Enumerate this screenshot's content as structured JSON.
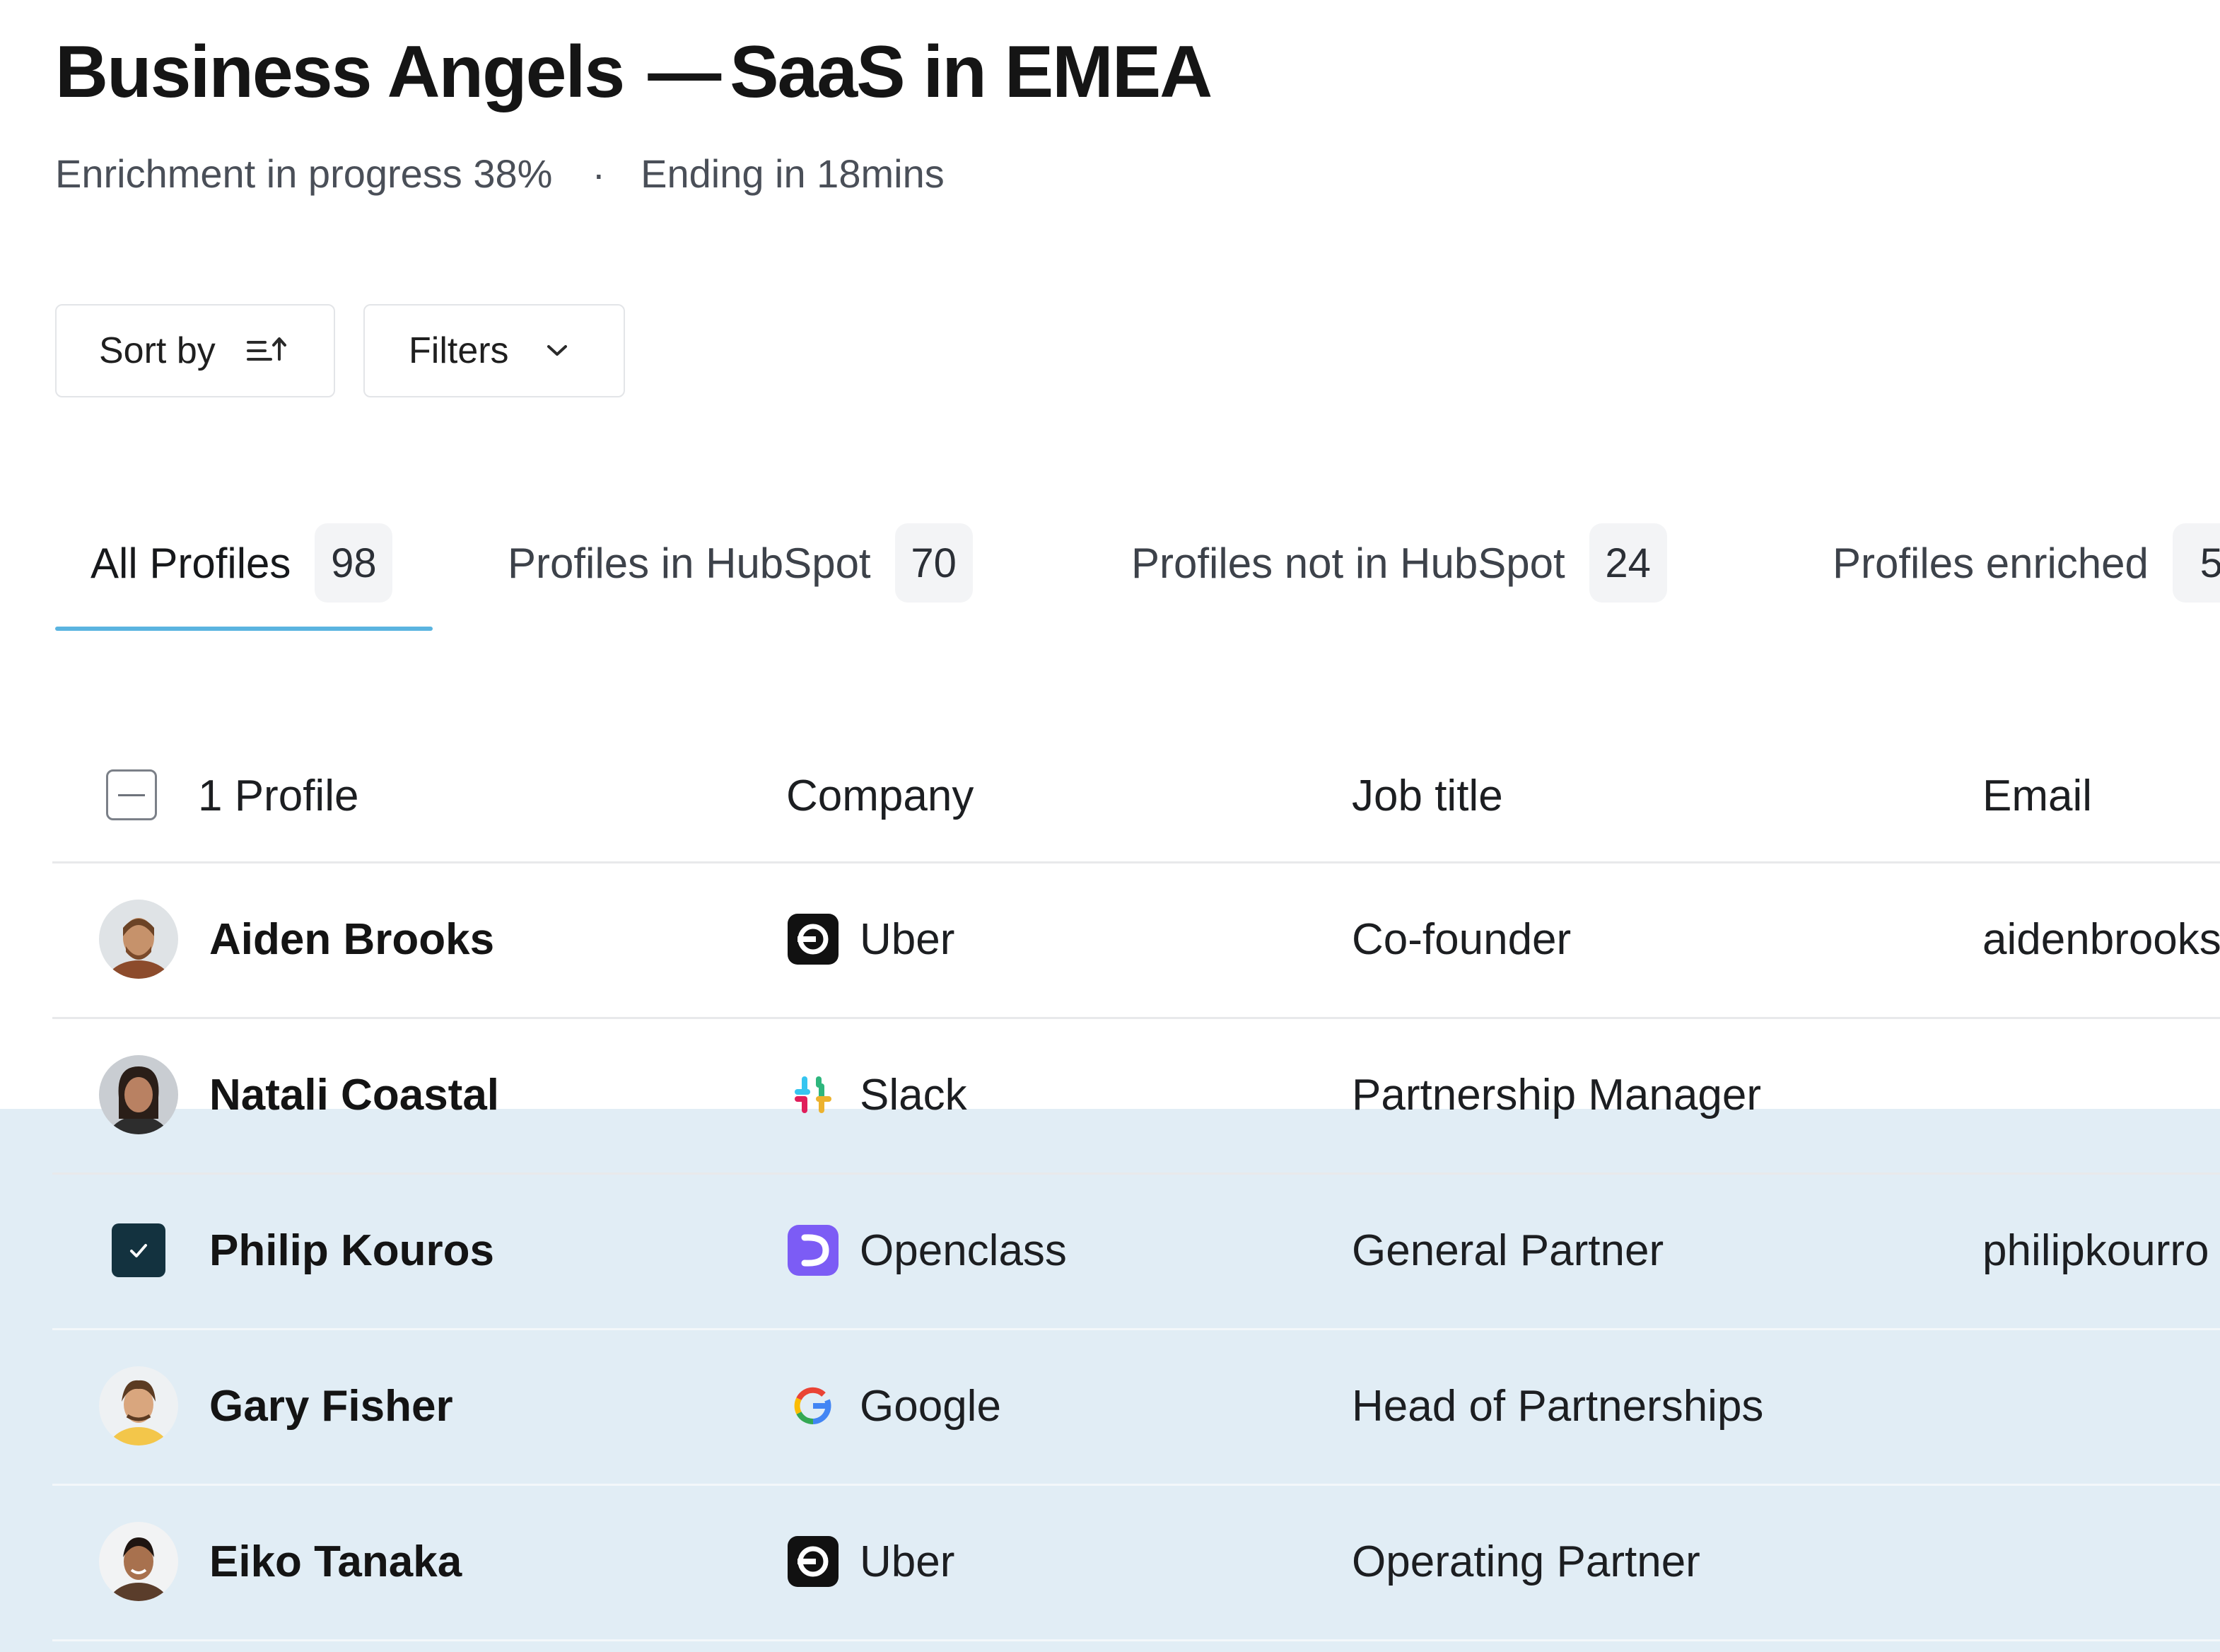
{
  "header": {
    "title_main": "Business Angels",
    "title_dash": "—",
    "title_rest": "SaaS in EMEA",
    "status": "Enrichment in progress 38%",
    "separator": "·",
    "ending": "Ending in 18mins"
  },
  "toolbar": {
    "sort_label": "Sort by",
    "filters_label": "Filters"
  },
  "tabs": [
    {
      "label": "All Profiles",
      "count": "98",
      "active": true
    },
    {
      "label": "Profiles in HubSpot",
      "count": "70",
      "active": false
    },
    {
      "label": "Profiles not in HubSpot",
      "count": "24",
      "active": false
    },
    {
      "label": "Profiles enriched",
      "count": "5",
      "active": false
    }
  ],
  "table": {
    "columns": {
      "profile": "1 Profile",
      "company": "Company",
      "job_title": "Job title",
      "email": "Email"
    },
    "rows": [
      {
        "name": "Aiden Brooks",
        "company": "Uber",
        "company_icon": "uber-icon",
        "job": "Co-founder",
        "email": "aidenbrooks",
        "selected": false
      },
      {
        "name": "Natali Coastal",
        "company": "Slack",
        "company_icon": "slack-icon",
        "job": "Partnership Manager",
        "email": "",
        "selected": false
      },
      {
        "name": "Philip Kouros",
        "company": "Openclass",
        "company_icon": "openclass-icon",
        "job": "General Partner",
        "email": "philipkourro",
        "selected": true
      },
      {
        "name": "Gary Fisher",
        "company": "Google",
        "company_icon": "google-icon",
        "job": "Head of Partnerships",
        "email": "",
        "selected": false
      },
      {
        "name": "Eiko Tanaka",
        "company": "Uber",
        "company_icon": "uber-icon",
        "job": "Operating Partner",
        "email": "",
        "selected": false
      }
    ]
  },
  "colors": {
    "accent": "#5ab4e0",
    "selection_band": "#e1edf5",
    "checkbox_checked": "#13323f",
    "openclass": "#7c5cf5",
    "uber": "#111111"
  }
}
